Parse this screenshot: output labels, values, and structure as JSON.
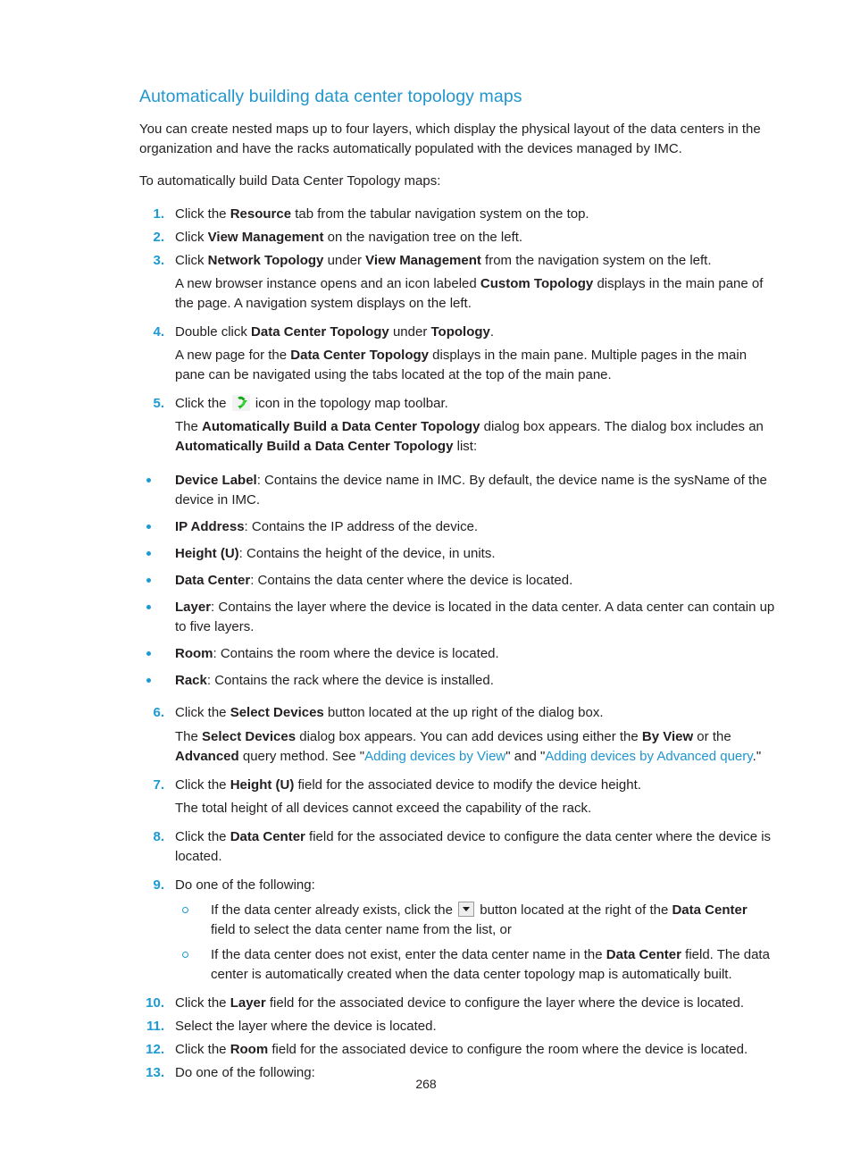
{
  "document": {
    "section_title": "Automatically building data center topology maps",
    "page_number": "268",
    "colors": {
      "heading": "#2196ce",
      "link": "#2196ce",
      "list_number": "#1b9ad6",
      "bullet": "#1b9ad6",
      "body_text": "#231f20"
    },
    "intro_paragraphs": [
      "You can create nested maps up to four layers, which display the physical layout of the data centers in the organization and have the racks automatically populated with the devices managed by IMC.",
      "To automatically build Data Center Topology maps:"
    ],
    "steps": [
      {
        "number": "1.",
        "parts": [
          {
            "t": "Click the ",
            "b": false
          },
          {
            "t": "Resource",
            "b": true
          },
          {
            "t": " tab from the tabular navigation system on the top.",
            "b": false
          }
        ],
        "notes": []
      },
      {
        "number": "2.",
        "parts": [
          {
            "t": "Click ",
            "b": false
          },
          {
            "t": "View Management",
            "b": true
          },
          {
            "t": " on the navigation tree on the left.",
            "b": false
          }
        ],
        "notes": []
      },
      {
        "number": "3.",
        "parts": [
          {
            "t": "Click ",
            "b": false
          },
          {
            "t": "Network Topology",
            "b": true
          },
          {
            "t": " under ",
            "b": false
          },
          {
            "t": "View Management",
            "b": true
          },
          {
            "t": " from the navigation system on the left.",
            "b": false
          }
        ],
        "notes": [
          [
            {
              "t": "A new browser instance opens and an icon labeled ",
              "b": false
            },
            {
              "t": "Custom Topology",
              "b": true
            },
            {
              "t": " displays in the main pane of the page. A navigation system displays on the left.",
              "b": false
            }
          ]
        ]
      },
      {
        "number": "4.",
        "parts": [
          {
            "t": "Double click ",
            "b": false
          },
          {
            "t": "Data Center Topology",
            "b": true
          },
          {
            "t": " under ",
            "b": false
          },
          {
            "t": "Topology",
            "b": true
          },
          {
            "t": ".",
            "b": false
          }
        ],
        "notes": [
          [
            {
              "t": "A new page for the ",
              "b": false
            },
            {
              "t": "Data Center Topology",
              "b": true
            },
            {
              "t": " displays in the main pane. Multiple pages in the main pane can be navigated using the tabs located at the top of the main pane.",
              "b": false
            }
          ]
        ]
      },
      {
        "number": "5.",
        "parts_before_icon": "Click the ",
        "icon": "build-topology-green-arrow-icon",
        "parts_after_icon": " icon in the topology map toolbar.",
        "notes": [
          [
            {
              "t": "The ",
              "b": false
            },
            {
              "t": "Automatically Build a Data Center Topology",
              "b": true
            },
            {
              "t": " dialog box appears. The dialog box includes an ",
              "b": false
            },
            {
              "t": "Automatically Build a Data Center Topology",
              "b": true
            },
            {
              "t": " list:",
              "b": false
            }
          ]
        ]
      },
      {
        "number": "6.",
        "parts": [
          {
            "t": "Click the ",
            "b": false
          },
          {
            "t": "Select Devices",
            "b": true
          },
          {
            "t": " button located at the up right of the dialog box.",
            "b": false
          }
        ],
        "notes": []
      },
      {
        "number": "7.",
        "parts": [
          {
            "t": "Click the ",
            "b": false
          },
          {
            "t": "Height (U)",
            "b": true
          },
          {
            "t": " field for the associated device to modify the device height.",
            "b": false
          }
        ],
        "notes": [
          [
            {
              "t": "The total height of all devices cannot exceed the capability of the rack.",
              "b": false
            }
          ]
        ]
      },
      {
        "number": "8.",
        "parts": [
          {
            "t": "Click the ",
            "b": false
          },
          {
            "t": "Data Center",
            "b": true
          },
          {
            "t": " field for the associated device to configure the data center where the device is located.",
            "b": false
          }
        ],
        "notes": []
      },
      {
        "number": "9.",
        "parts": [
          {
            "t": "Do one of the following:",
            "b": false
          }
        ],
        "notes": []
      },
      {
        "number": "10.",
        "parts": [
          {
            "t": "Click the ",
            "b": false
          },
          {
            "t": "Layer",
            "b": true
          },
          {
            "t": " field for the associated device to configure the layer where the device is located.",
            "b": false
          }
        ],
        "notes": []
      },
      {
        "number": "11.",
        "parts": [
          {
            "t": "Select the layer where the device is located.",
            "b": false
          }
        ],
        "notes": []
      },
      {
        "number": "12.",
        "parts": [
          {
            "t": "Click the ",
            "b": false
          },
          {
            "t": "Room",
            "b": true
          },
          {
            "t": " field for the associated device to configure the room where the device is located.",
            "b": false
          }
        ],
        "notes": []
      },
      {
        "number": "13.",
        "parts": [
          {
            "t": "Do one of the following:",
            "b": false
          }
        ],
        "notes": []
      }
    ],
    "field_bullets": [
      {
        "term": "Device Label",
        "desc": ": Contains the device name in IMC. By default, the device name is the sysName of the device in IMC."
      },
      {
        "term": "IP Address",
        "desc": ": Contains the IP address of the device."
      },
      {
        "term": "Height (U)",
        "desc": ": Contains the height of the device, in units."
      },
      {
        "term": "Data Center",
        "desc": ": Contains the data center where the device is located."
      },
      {
        "term": "Layer",
        "desc": ": Contains the layer where the device is located in the data center. A data center can contain up to five layers."
      },
      {
        "term": "Room",
        "desc": ": Contains the room where the device is located."
      },
      {
        "term": "Rack",
        "desc": ": Contains the rack where the device is installed."
      }
    ],
    "step6_note": {
      "lead": "The ",
      "bold1": "Select Devices",
      "mid1": " dialog box appears. You can add devices using either the ",
      "bold2": "By View",
      "mid2": " or the ",
      "bold3": "Advanced",
      "mid3": " query method. See \"",
      "link1": "Adding devices by View",
      "mid4": "\" and \"",
      "link2": "Adding devices by Advanced query",
      "tail": ".\""
    },
    "step9_options": {
      "option1": {
        "lead": "If the data center already exists, click the ",
        "icon": "dropdown-arrow-icon",
        "mid": " button located at the right of the ",
        "bold": "Data Center",
        "tail": " field to select the data center name from the list, or"
      },
      "option2": {
        "lead": "If the data center does not exist, enter the data center name in the ",
        "bold": "Data Center",
        "tail": " field. The data center is automatically created when the data center topology map is automatically built."
      }
    }
  }
}
